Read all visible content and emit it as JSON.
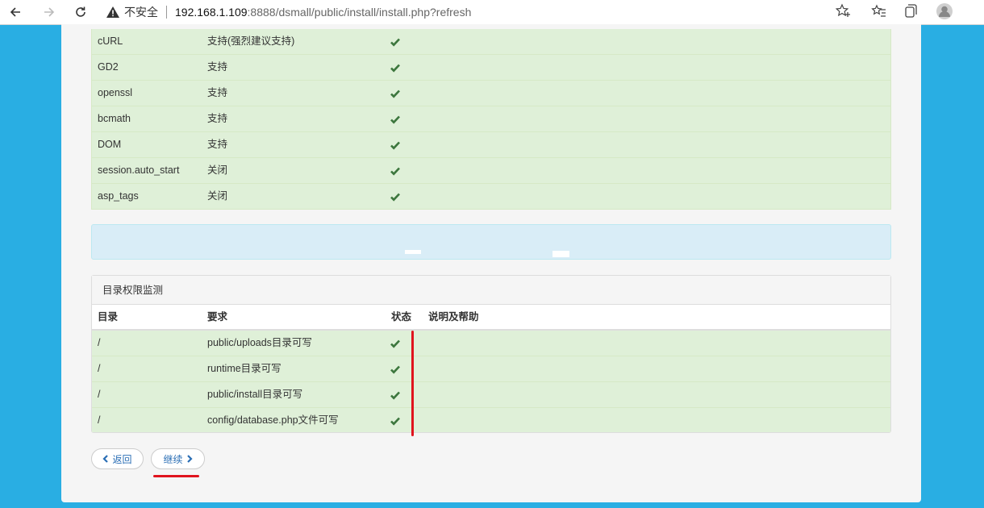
{
  "browser": {
    "security_label": "不安全",
    "url_host": "192.168.1.109",
    "url_rest": ":8888/dsmall/public/install/install.php?refresh"
  },
  "env_rows": [
    {
      "name": "cURL",
      "value": "支持(强烈建议支持)"
    },
    {
      "name": "GD2",
      "value": "支持"
    },
    {
      "name": "openssl",
      "value": "支持"
    },
    {
      "name": "bcmath",
      "value": "支持"
    },
    {
      "name": "DOM",
      "value": "支持"
    },
    {
      "name": "session.auto_start",
      "value": "关闭"
    },
    {
      "name": "asp_tags",
      "value": "关闭"
    }
  ],
  "dir_panel": {
    "title": "目录权限监测",
    "headers": {
      "dir": "目录",
      "req": "要求",
      "status": "状态",
      "help": "说明及帮助"
    },
    "rows": [
      {
        "dir": "/",
        "req": "public/uploads目录可写"
      },
      {
        "dir": "/",
        "req": "runtime目录可写"
      },
      {
        "dir": "/",
        "req": "public/install目录可写"
      },
      {
        "dir": "/",
        "req": "config/database.php文件可写"
      }
    ]
  },
  "buttons": {
    "back": "返回",
    "next": "继续"
  },
  "colors": {
    "success_bg": "#dff0d8",
    "check": "#3c763d",
    "info_bg": "#d9edf7",
    "page_bg": "#29aee3",
    "annotation": "#e0141e"
  }
}
